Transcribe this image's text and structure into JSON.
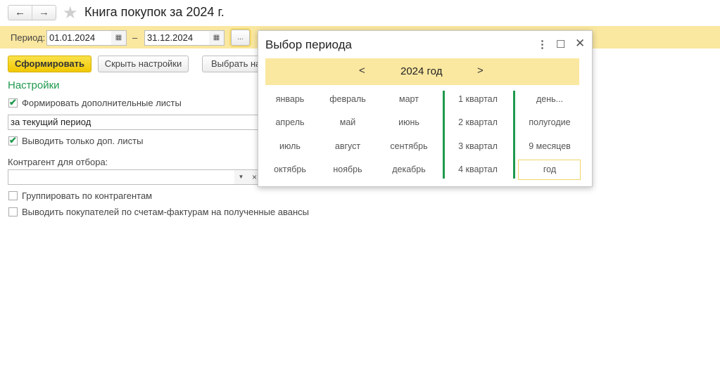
{
  "header": {
    "back": "←",
    "forward": "→",
    "title": "Книга покупок за 2024 г."
  },
  "period": {
    "label": "Период:",
    "from": "01.01.2024",
    "dash": "–",
    "to": "31.12.2024",
    "more": "..."
  },
  "toolbar": {
    "generate": "Сформировать",
    "hide_settings": "Скрыть настройки",
    "choose": "Выбрать на"
  },
  "settings": {
    "heading": "Настройки",
    "extra_sheets": {
      "label": "Формировать дополнительные листы",
      "checked": true
    },
    "extra_period": "за текущий период",
    "only_extra": {
      "label": "Выводить только доп. листы",
      "checked": true
    },
    "counterparty_label": "Контрагент для отбора:",
    "counterparty_value": "",
    "group_by": {
      "label": "Группировать по контрагентам",
      "checked": false
    },
    "advances": {
      "label": "Выводить покупателей по счетам-фактурам на полученные авансы",
      "checked": false
    }
  },
  "popup": {
    "title": "Выбор периода",
    "year": "2024 год",
    "prev": "<",
    "next": ">",
    "months": [
      "январь",
      "февраль",
      "март",
      "апрель",
      "май",
      "июнь",
      "июль",
      "август",
      "сентябрь",
      "октябрь",
      "ноябрь",
      "декабрь"
    ],
    "quarters": [
      "1 квартал",
      "2 квартал",
      "3 квартал",
      "4 квартал"
    ],
    "other": [
      "день...",
      "полугодие",
      "9 месяцев",
      "год"
    ],
    "selected": "год"
  },
  "colors": {
    "accent_yellow": "#fae7a0",
    "green": "#1e9a4d",
    "primary": "#f0c800"
  }
}
